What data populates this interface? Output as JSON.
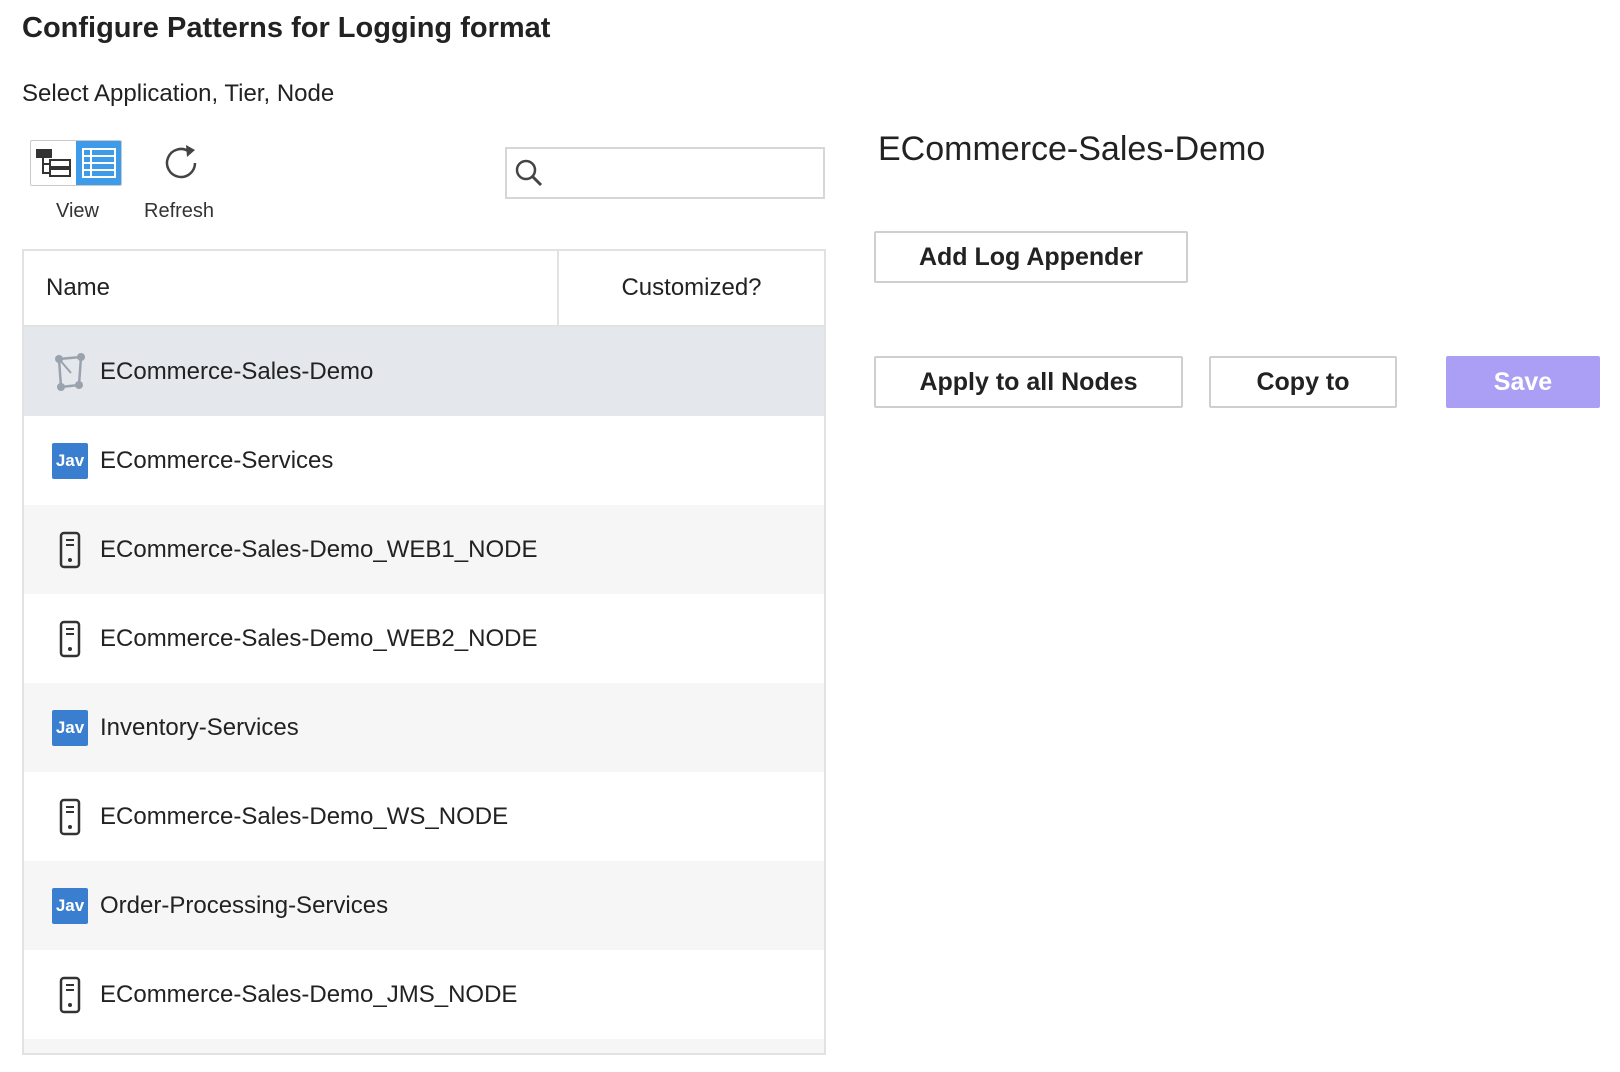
{
  "page": {
    "title": "Configure Patterns for Logging format",
    "subtitle": "Select Application, Tier, Node"
  },
  "toolbar": {
    "view_label": "View",
    "refresh_label": "Refresh",
    "view_mode": "list",
    "icons": {
      "tree": "tree-view-icon",
      "list": "list-view-icon",
      "refresh": "refresh-icon"
    }
  },
  "search": {
    "value": "",
    "placeholder": "",
    "icon": "search-icon"
  },
  "grid": {
    "columns": {
      "name": "Name",
      "customized": "Customized?"
    },
    "rows": [
      {
        "label": "ECommerce-Sales-Demo",
        "type": "application",
        "icon": "application-icon",
        "selected": true
      },
      {
        "label": "ECommerce-Services",
        "type": "tier",
        "icon": "java-tier-icon",
        "badge": "Jav"
      },
      {
        "label": "ECommerce-Sales-Demo_WEB1_NODE",
        "type": "node",
        "icon": "server-node-icon"
      },
      {
        "label": "ECommerce-Sales-Demo_WEB2_NODE",
        "type": "node",
        "icon": "server-node-icon"
      },
      {
        "label": "Inventory-Services",
        "type": "tier",
        "icon": "java-tier-icon",
        "badge": "Jav"
      },
      {
        "label": "ECommerce-Sales-Demo_WS_NODE",
        "type": "node",
        "icon": "server-node-icon"
      },
      {
        "label": "Order-Processing-Services",
        "type": "tier",
        "icon": "java-tier-icon",
        "badge": "Jav"
      },
      {
        "label": "ECommerce-Sales-Demo_JMS_NODE",
        "type": "node",
        "icon": "server-node-icon"
      }
    ]
  },
  "detail": {
    "heading": "ECommerce-Sales-Demo",
    "add_log_appender": "Add Log Appender",
    "apply_all_nodes": "Apply to all Nodes",
    "copy_to": "Copy to",
    "save": "Save"
  },
  "colors": {
    "accent": "#3d9be9",
    "java_badge": "#3a7ecf",
    "save_disabled": "#ab9ff5",
    "selected_row": "#e4e7ec",
    "alt_row": "#f6f6f6"
  }
}
